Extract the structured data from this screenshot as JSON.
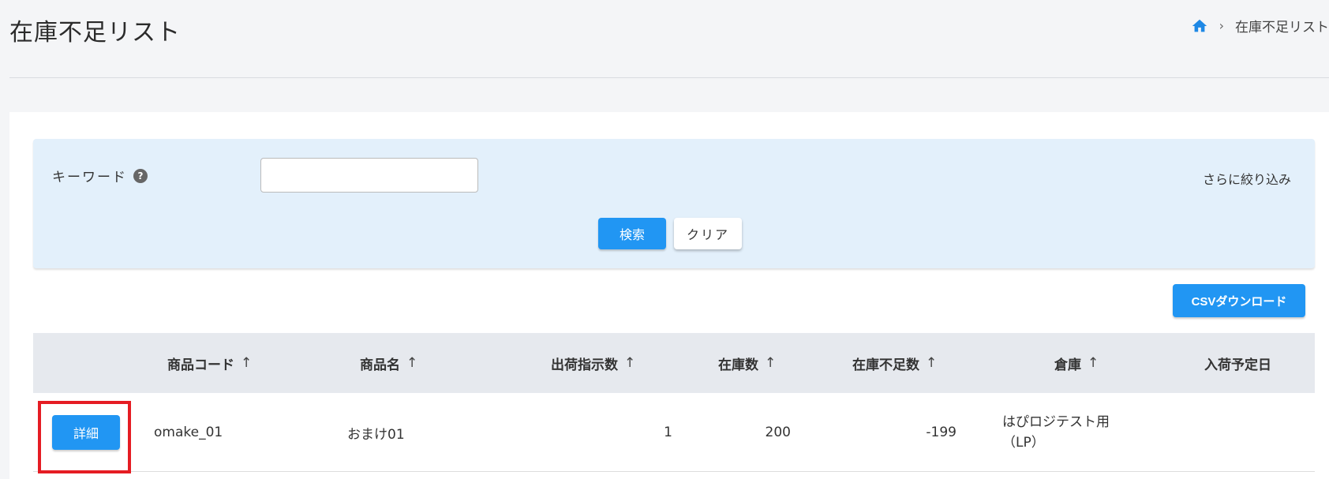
{
  "page": {
    "title": "在庫不足リスト"
  },
  "breadcrumb": {
    "current": "在庫不足リスト",
    "separator": "›"
  },
  "search": {
    "keyword_label": "キーワード",
    "help_glyph": "?",
    "keyword_value": "",
    "keyword_placeholder": "",
    "more_filter": "さらに絞り込み",
    "search_button": "検索",
    "clear_button": "クリア"
  },
  "actions": {
    "csv_download": "CSVダウンロード"
  },
  "table": {
    "sort_indicator": "↑",
    "columns": [
      "",
      "商品コード",
      "商品名",
      "出荷指示数",
      "在庫数",
      "在庫不足数",
      "倉庫",
      "入荷予定日"
    ],
    "rows": [
      {
        "detail_button": "詳細",
        "code": "omake_01",
        "name": "おまけ01",
        "ship_qty": "1",
        "stock_qty": "200",
        "shortage": "-199",
        "warehouse": "はぴロジテスト用（LP）",
        "arrival_date": ""
      }
    ]
  },
  "colors": {
    "primary": "#2196f3",
    "highlight": "#e51c23",
    "search_panel_bg": "#e3f0fb",
    "table_head_bg": "#e6e9ee"
  },
  "icons": {
    "home": "home-icon",
    "help": "help-icon",
    "sort": "arrow-up-icon"
  }
}
